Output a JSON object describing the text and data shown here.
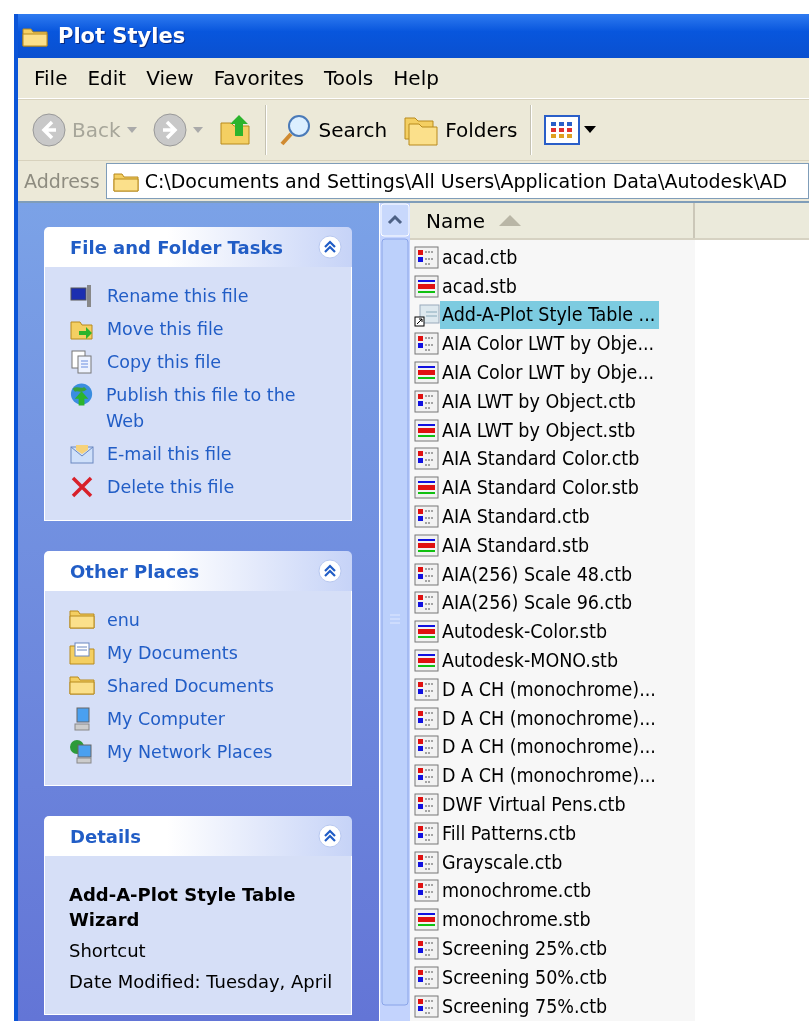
{
  "window": {
    "title": "Plot Styles"
  },
  "menu": [
    "File",
    "Edit",
    "View",
    "Favorites",
    "Tools",
    "Help"
  ],
  "toolbar": [
    {
      "kind": "back",
      "label": "Back",
      "disabled": true
    },
    {
      "kind": "forward",
      "disabled": true
    },
    {
      "kind": "up"
    },
    {
      "kind": "separator"
    },
    {
      "kind": "search",
      "label": "Search"
    },
    {
      "kind": "folders",
      "label": "Folders"
    },
    {
      "kind": "separator"
    },
    {
      "kind": "views"
    }
  ],
  "address": {
    "label": "Address",
    "value": "C:\\Documents and Settings\\All Users\\Application Data\\Autodesk\\AD"
  },
  "sidebar": [
    {
      "kind": "links",
      "title": "File and Folder Tasks",
      "expanded": true,
      "items": [
        {
          "kind": "rename",
          "label": "Rename this file"
        },
        {
          "kind": "move",
          "label": "Move this file"
        },
        {
          "kind": "copy",
          "label": "Copy this file"
        },
        {
          "kind": "publish",
          "label": "Publish this file to the Web"
        },
        {
          "kind": "email",
          "label": "E-mail this file"
        },
        {
          "kind": "delete",
          "label": "Delete this file"
        }
      ]
    },
    {
      "kind": "links",
      "title": "Other Places",
      "expanded": true,
      "items": [
        {
          "kind": "folder",
          "label": "enu"
        },
        {
          "kind": "documents",
          "label": "My Documents"
        },
        {
          "kind": "folder",
          "label": "Shared Documents"
        },
        {
          "kind": "computer",
          "label": "My Computer"
        },
        {
          "kind": "network",
          "label": "My Network Places"
        }
      ]
    },
    {
      "kind": "details",
      "title": "Details",
      "expanded": true,
      "name": "Add-A-Plot Style Table Wizard",
      "type": "Shortcut",
      "modified": "Date Modified: Tuesday, April"
    }
  ],
  "file_list": {
    "column": "Name",
    "sort_ascending": true,
    "files": [
      {
        "name": "acad.ctb",
        "kind": "ctb",
        "selected": false
      },
      {
        "name": "acad.stb",
        "kind": "stb",
        "selected": false
      },
      {
        "name": "Add-A-Plot Style Table ...",
        "kind": "shortcut",
        "selected": true
      },
      {
        "name": "AIA Color LWT by Obje...",
        "kind": "ctb",
        "selected": false
      },
      {
        "name": "AIA Color LWT by Obje...",
        "kind": "stb",
        "selected": false
      },
      {
        "name": "AIA LWT by Object.ctb",
        "kind": "ctb",
        "selected": false
      },
      {
        "name": "AIA LWT by Object.stb",
        "kind": "stb",
        "selected": false
      },
      {
        "name": "AIA Standard Color.ctb",
        "kind": "ctb",
        "selected": false
      },
      {
        "name": "AIA Standard Color.stb",
        "kind": "stb",
        "selected": false
      },
      {
        "name": "AIA Standard.ctb",
        "kind": "ctb",
        "selected": false
      },
      {
        "name": "AIA Standard.stb",
        "kind": "stb",
        "selected": false
      },
      {
        "name": "AIA(256) Scale 48.ctb",
        "kind": "ctb",
        "selected": false
      },
      {
        "name": "AIA(256) Scale 96.ctb",
        "kind": "ctb",
        "selected": false
      },
      {
        "name": "Autodesk-Color.stb",
        "kind": "stb",
        "selected": false
      },
      {
        "name": "Autodesk-MONO.stb",
        "kind": "stb",
        "selected": false
      },
      {
        "name": "D A CH (monochrome)...",
        "kind": "ctb",
        "selected": false
      },
      {
        "name": "D A CH (monochrome)...",
        "kind": "ctb",
        "selected": false
      },
      {
        "name": "D A CH (monochrome)...",
        "kind": "ctb",
        "selected": false
      },
      {
        "name": "D A CH (monochrome)...",
        "kind": "ctb",
        "selected": false
      },
      {
        "name": "DWF Virtual Pens.ctb",
        "kind": "ctb",
        "selected": false
      },
      {
        "name": "Fill Patterns.ctb",
        "kind": "ctb",
        "selected": false
      },
      {
        "name": "Grayscale.ctb",
        "kind": "ctb",
        "selected": false
      },
      {
        "name": "monochrome.ctb",
        "kind": "ctb",
        "selected": false
      },
      {
        "name": "monochrome.stb",
        "kind": "stb",
        "selected": false
      },
      {
        "name": "Screening 25%.ctb",
        "kind": "ctb",
        "selected": false
      },
      {
        "name": "Screening 50%.ctb",
        "kind": "ctb",
        "selected": false
      },
      {
        "name": "Screening 75%.ctb",
        "kind": "ctb",
        "selected": false
      }
    ]
  }
}
